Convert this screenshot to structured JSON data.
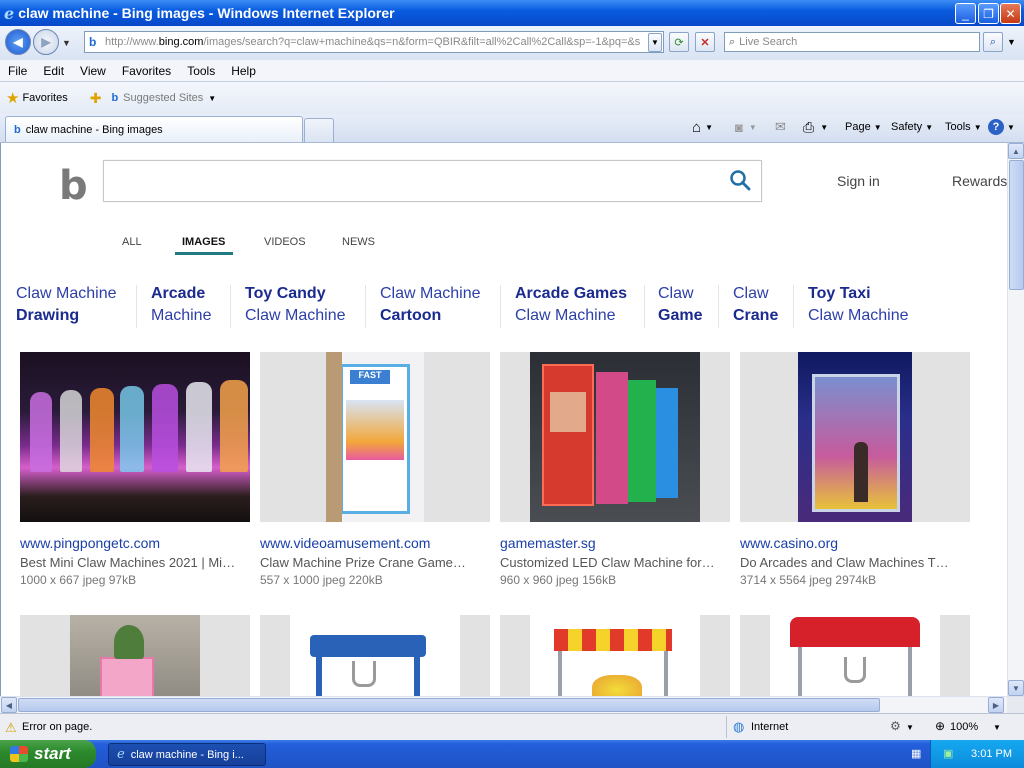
{
  "window": {
    "title": "claw machine - Bing images - Windows Internet Explorer"
  },
  "nav": {
    "url_prefix": "http://www.",
    "url_host": "bing.com",
    "url_rest": "/images/search?q=claw+machine&qs=n&form=QBIR&filt=all%2Call%2Call&sp=-1&pq=&s",
    "live_search_placeholder": "Live Search"
  },
  "menu": [
    "File",
    "Edit",
    "View",
    "Favorites",
    "Tools",
    "Help"
  ],
  "favorites": {
    "label": "Favorites",
    "suggested": "Suggested Sites"
  },
  "tab": {
    "title": "claw machine - Bing images"
  },
  "commandbar": {
    "page": "Page",
    "safety": "Safety",
    "tools": "Tools"
  },
  "bing": {
    "sign_in": "Sign in",
    "rewards": "Rewards",
    "scopes": [
      "ALL",
      "IMAGES",
      "VIDEOS",
      "NEWS"
    ],
    "active_scope": "IMAGES",
    "related": [
      {
        "line1": "Claw Machine",
        "line2": "Drawing",
        "bold_line": 2
      },
      {
        "line1": "Arcade",
        "line2": "Machine",
        "bold_line": 1
      },
      {
        "line1": "Toy Candy",
        "line2": "Claw Machine",
        "bold_line": 1
      },
      {
        "line1": "Claw Machine",
        "line2": "Cartoon",
        "bold_line": 2
      },
      {
        "line1": "Arcade Games",
        "line2": "Claw Machine",
        "bold_line": 1
      },
      {
        "line1": "Claw",
        "line2": "Game",
        "bold_line": 2
      },
      {
        "line1": "Claw",
        "line2": "Crane",
        "bold_line": 2
      },
      {
        "line1": "Toy Taxi",
        "line2": "Claw Machine",
        "bold_line": 1
      }
    ],
    "results": [
      {
        "site": "www.pingpongetc.com",
        "desc": "Best Mini Claw Machines 2021 | Mi…",
        "meta": "1000 x 667 jpeg 97kB"
      },
      {
        "site": "www.videoamusement.com",
        "desc": "Claw Machine Prize Crane Game…",
        "meta": "557 x 1000 jpeg 220kB"
      },
      {
        "site": "gamemaster.sg",
        "desc": "Customized LED Claw Machine for…",
        "meta": "960 x 960 jpeg 156kB"
      },
      {
        "site": "www.casino.org",
        "desc": "Do Arcades and Claw Machines T…",
        "meta": "3714 x 5564 jpeg 2974kB"
      }
    ]
  },
  "status": {
    "error": "Error on page.",
    "zone": "Internet",
    "zoom": "100%"
  },
  "taskbar": {
    "start": "start",
    "item": "claw machine - Bing i...",
    "clock": "3:01 PM"
  }
}
